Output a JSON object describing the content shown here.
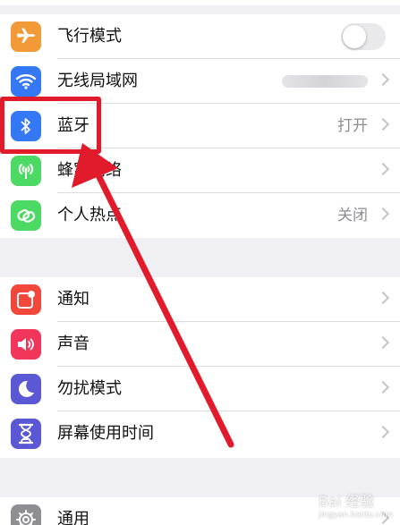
{
  "group1": {
    "airplane": {
      "label": "飞行模式",
      "icon": "airplane-icon",
      "toggle_on": false
    },
    "wifi": {
      "label": "无线局域网",
      "icon": "wifi-icon"
    },
    "bluetooth": {
      "label": "蓝牙",
      "icon": "bluetooth-icon",
      "value": "打开"
    },
    "cellular": {
      "label": "蜂窝网络",
      "icon": "cellular-antenna-icon"
    },
    "hotspot": {
      "label": "个人热点",
      "icon": "hotspot-link-icon",
      "value": "关闭"
    }
  },
  "group2": {
    "notifications": {
      "label": "通知",
      "icon": "notifications-icon"
    },
    "sounds": {
      "label": "声音",
      "icon": "speaker-icon"
    },
    "dnd": {
      "label": "勿扰模式",
      "icon": "moon-icon"
    },
    "screentime": {
      "label": "屏幕使用时间",
      "icon": "hourglass-icon"
    }
  },
  "group3": {
    "general": {
      "label": "通用",
      "icon": "gear-icon"
    }
  },
  "colors": {
    "airplane": "#f19a37",
    "wifi": "#3478f6",
    "bluetooth": "#3478f6",
    "cellular": "#4cd964",
    "hotspot": "#4cd964",
    "notifications": "#f2473a",
    "sounds": "#f2355b",
    "dnd": "#5b58d6",
    "screentime": "#5b58d6",
    "general": "#8e8e93",
    "highlight": "#e21b2c"
  },
  "watermark": {
    "text": "Bai 经验",
    "sub": "jingyan.baidu.com"
  }
}
